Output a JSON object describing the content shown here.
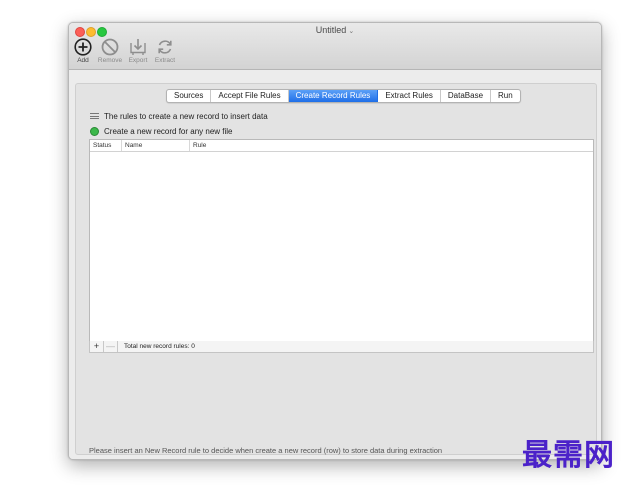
{
  "window": {
    "title": "Untitled"
  },
  "toolbar": {
    "add_label": "Add",
    "remove_label": "Remove",
    "export_label": "Export",
    "extract_label": "Extract"
  },
  "tabs": [
    "Sources",
    "Accept File Rules",
    "Create Record Rules",
    "Extract Rules",
    "DataBase",
    "Run"
  ],
  "active_tab": "Create Record Rules",
  "section": {
    "heading": "The rules to create a new record to insert data",
    "option": "Create a new record for any new file"
  },
  "table": {
    "columns": [
      "Status",
      "Name",
      "Rule"
    ],
    "rows": []
  },
  "footer": {
    "add_symbol": "+",
    "remove_symbol": "—",
    "total": "Total new record rules: 0"
  },
  "hint": "Please insert an New Record rule to decide when create a new record (row) to store data during extraction",
  "watermark": "最需网",
  "colors": {
    "accent": "#1f6fe8",
    "status_green": "#3cb84a",
    "watermark": "#4b22c9"
  }
}
